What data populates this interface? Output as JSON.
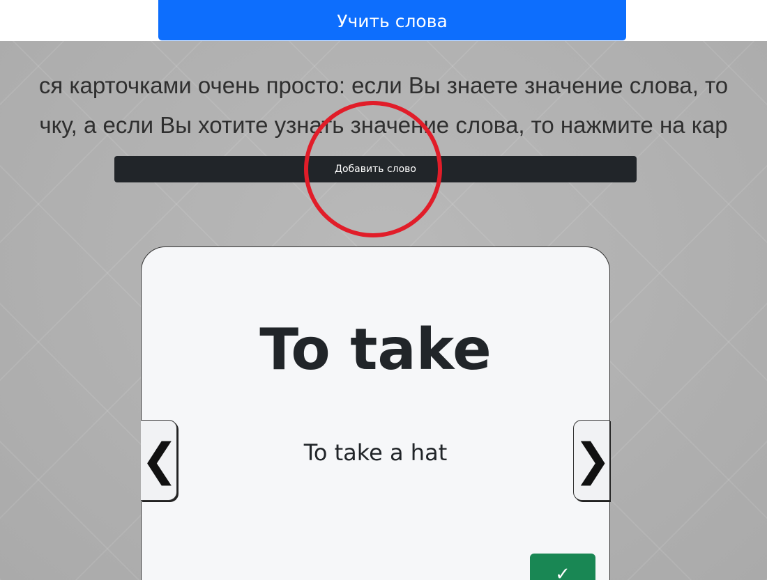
{
  "header": {
    "learn_button_label": "Учить слова"
  },
  "instructions": {
    "line1": "ся карточками очень просто: если Вы знаете значение слова, то",
    "line2": "чку, а если Вы хотите узнать значение слова, то нажмите на кар"
  },
  "actions": {
    "add_word_label": "Добавить слово"
  },
  "card": {
    "word": "To take",
    "example": "To take a hat",
    "prev_label": "❮",
    "next_label": "❯",
    "know_label": "✓"
  },
  "colors": {
    "primary": "#0d6efd",
    "dark": "#212529",
    "success": "#198754",
    "highlight": "#e11d29",
    "background": "#b1b1b1"
  }
}
